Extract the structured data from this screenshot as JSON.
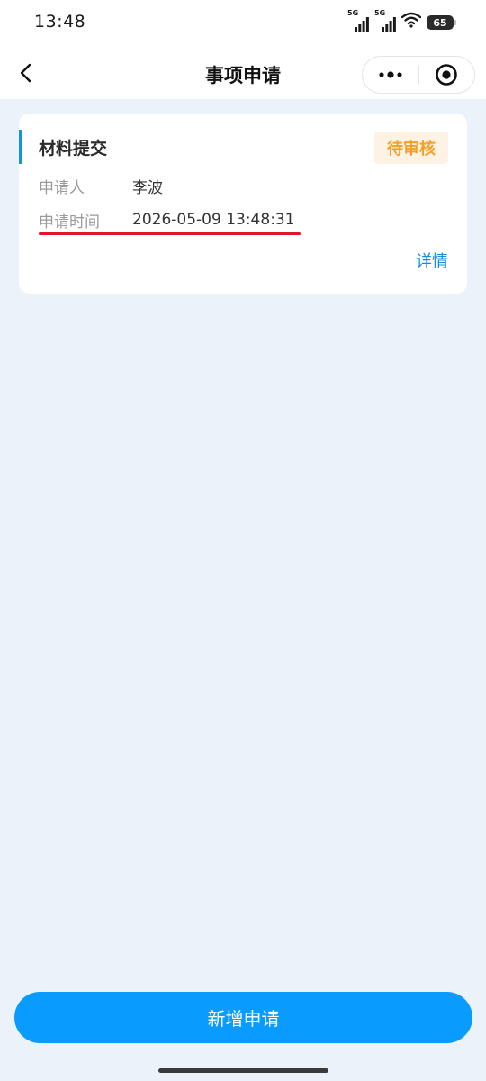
{
  "status_bar": {
    "time": "13:48",
    "signal1_label": "5G",
    "signal2_label": "5G",
    "battery": "65",
    "icons": [
      "signal-icon",
      "signal-icon",
      "wifi-icon",
      "battery-icon"
    ]
  },
  "nav": {
    "title": "事项申请",
    "back_icon": "chevron-left-icon",
    "more_icon": "more-dots-icon",
    "close_icon": "target-circle-icon"
  },
  "card": {
    "title": "材料提交",
    "status": "待审核",
    "applicant_label": "申请人",
    "applicant_value": "李波",
    "time_label": "申请时间",
    "time_value": "2026-05-09 13:48:31",
    "detail_label": "详情"
  },
  "actions": {
    "add_label": "新增申请"
  },
  "colors": {
    "accent": "#1296db",
    "primary_button": "#0a9bff",
    "badge_text": "#f5a024",
    "badge_bg": "#fdf2e3",
    "underline": "#e0152b",
    "page_bg": "#ecf2f9"
  }
}
